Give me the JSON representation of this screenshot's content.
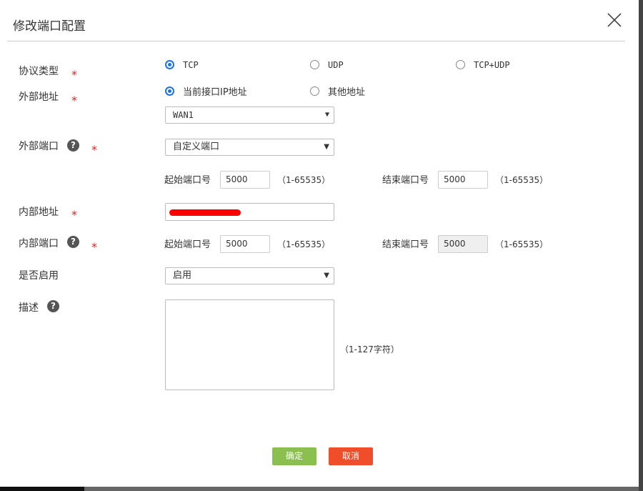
{
  "dialog": {
    "title": "修改端口配置"
  },
  "form": {
    "protocol": {
      "label": "协议类型",
      "options": [
        "TCP",
        "UDP",
        "TCP+UDP"
      ],
      "selected": "TCP"
    },
    "external_address": {
      "label": "外部地址",
      "options": [
        "当前接口IP地址",
        "其他地址"
      ],
      "selected": "当前接口IP地址",
      "interface": "WAN1"
    },
    "external_port": {
      "label": "外部端口",
      "mode": "自定义端口",
      "start_label": "起始端口号",
      "start": "5000",
      "end_label": "结束端口号",
      "end": "5000",
      "range": "（1-65535）"
    },
    "internal_address": {
      "label": "内部地址"
    },
    "internal_port": {
      "label": "内部端口",
      "start_label": "起始端口号",
      "start": "5000",
      "end_label": "结束端口号",
      "end": "5000",
      "range": "（1-65535）"
    },
    "enabled": {
      "label": "是否启用",
      "value": "启用"
    },
    "description": {
      "label": "描述",
      "hint": "（1-127字符）"
    },
    "required_mark": "*",
    "help_mark": "?"
  },
  "buttons": {
    "ok": "确定",
    "cancel": "取消"
  },
  "colors": {
    "ok": "#8bbf50",
    "cancel": "#f04e2a",
    "radio": "#1a73e8"
  }
}
